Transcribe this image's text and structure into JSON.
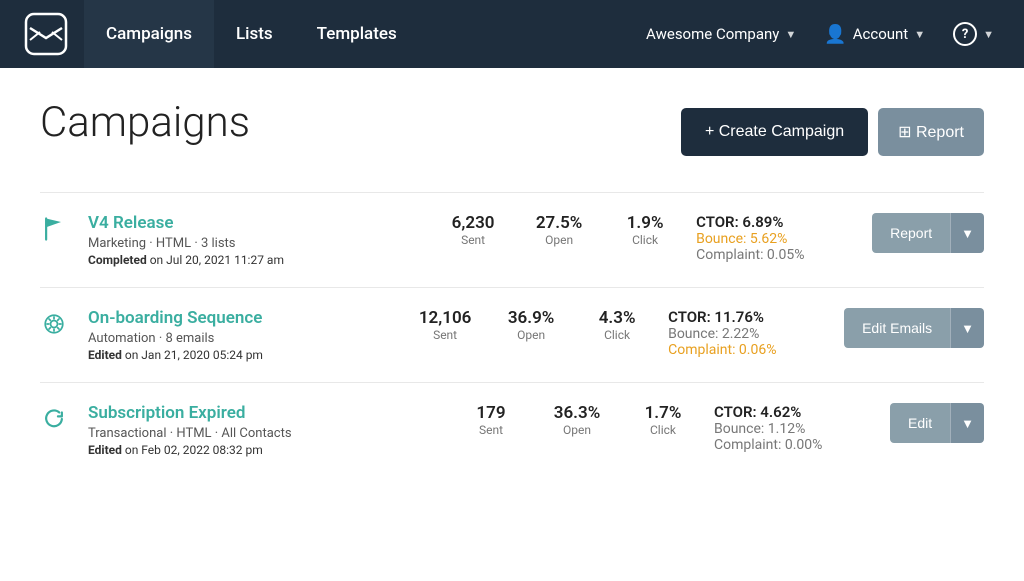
{
  "nav": {
    "logo_alt": "Mail logo",
    "items": [
      {
        "label": "Campaigns",
        "active": true
      },
      {
        "label": "Lists",
        "active": false
      },
      {
        "label": "Templates",
        "active": false
      }
    ],
    "company": "Awesome Company",
    "account": "Account",
    "help_icon": "?"
  },
  "page": {
    "title": "Campaigns",
    "create_button": "+ Create Campaign",
    "report_button": "⊞ Report"
  },
  "campaigns": [
    {
      "icon": "flag",
      "name": "V4 Release",
      "meta": "Marketing · HTML · 3 lists",
      "date_label": "Completed",
      "date": "Jul 20, 2021 11:27 am",
      "sent": "6,230",
      "sent_label": "Sent",
      "open": "27.5%",
      "open_label": "Open",
      "click": "1.9%",
      "click_label": "Click",
      "ctor": "CTOR: 6.89%",
      "bounce": "Bounce: 5.62%",
      "bounce_warning": true,
      "complaint": "Complaint: 0.05%",
      "complaint_warning": false,
      "action_label": "Report"
    },
    {
      "icon": "gear",
      "name": "On-boarding Sequence",
      "meta": "Automation · 8 emails",
      "date_label": "Edited",
      "date": "Jan 21, 2020 05:24 pm",
      "sent": "12,106",
      "sent_label": "Sent",
      "open": "36.9%",
      "open_label": "Open",
      "click": "4.3%",
      "click_label": "Click",
      "ctor": "CTOR: 11.76%",
      "bounce": "Bounce: 2.22%",
      "bounce_warning": false,
      "complaint": "Complaint: 0.06%",
      "complaint_warning": true,
      "action_label": "Edit Emails"
    },
    {
      "icon": "refresh",
      "name": "Subscription Expired",
      "meta": "Transactional · HTML · All Contacts",
      "date_label": "Edited",
      "date": "Feb 02, 2022 08:32 pm",
      "sent": "179",
      "sent_label": "Sent",
      "open": "36.3%",
      "open_label": "Open",
      "click": "1.7%",
      "click_label": "Click",
      "ctor": "CTOR: 4.62%",
      "bounce": "Bounce: 1.12%",
      "bounce_warning": false,
      "complaint": "Complaint: 0.00%",
      "complaint_warning": false,
      "action_label": "Edit"
    }
  ]
}
